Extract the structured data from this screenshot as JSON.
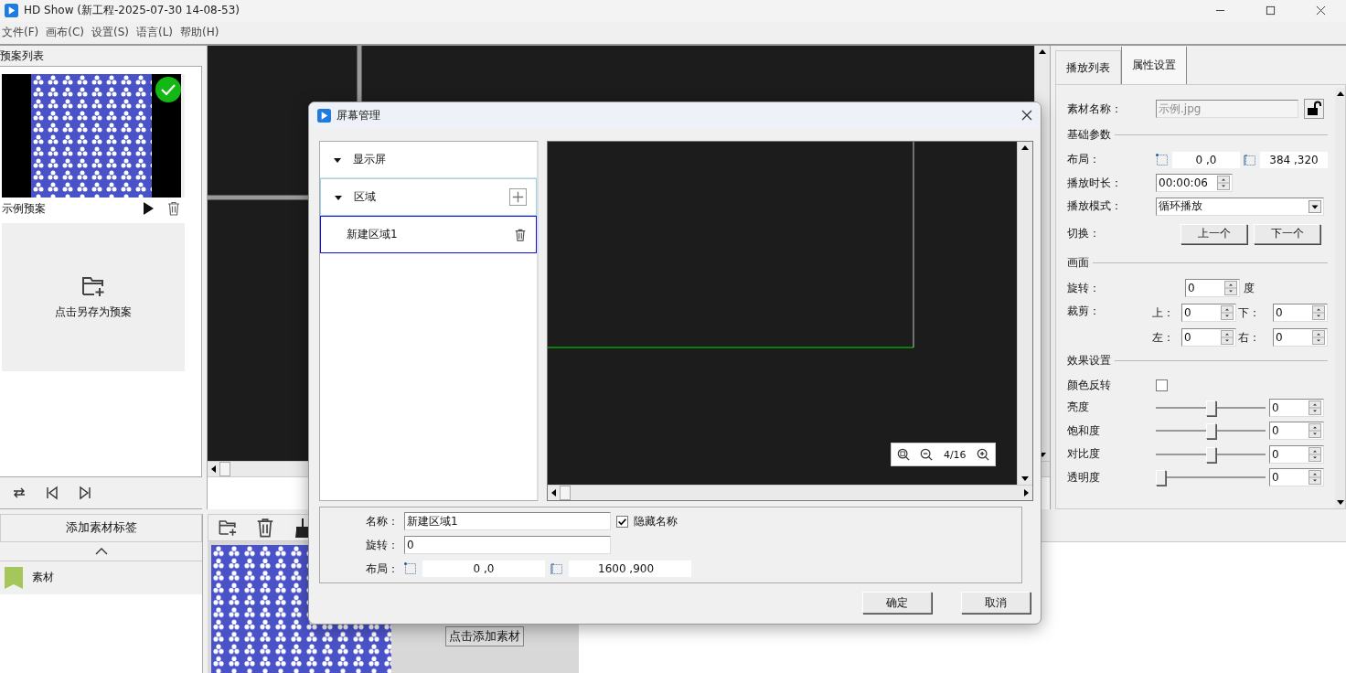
{
  "window": {
    "title": "HD Show (新工程-2025-07-30 14-08-53)"
  },
  "menu": [
    "文件(F)",
    "画布(C)",
    "设置(S)",
    "语言(L)",
    "帮助(H)"
  ],
  "presets": {
    "title": "预案列表",
    "items": [
      {
        "name": "示例预案",
        "selected": true,
        "kind": "picture"
      }
    ],
    "save_card": "点击另存为预案"
  },
  "material_tags": {
    "add_button": "添加素材标签",
    "tags": [
      {
        "name": "素材"
      }
    ]
  },
  "material_area": {
    "add_button": "点击添加素材"
  },
  "side_tabs": [
    {
      "label": "播放列表",
      "selected": false
    },
    {
      "label": "属性设置",
      "selected": true
    }
  ],
  "properties": {
    "material_name": {
      "label": "素材名称：",
      "value": "示例.jpg",
      "disabled": true
    },
    "basic": {
      "title": "基础参数",
      "layout": {
        "label": "布局：",
        "position": "0 ,0",
        "size": "384 ,320"
      },
      "duration": {
        "label": "播放时长：",
        "value": "00:00:06"
      },
      "mode": {
        "label": "播放模式：",
        "value": "循环播放"
      },
      "switch": {
        "label": "切换：",
        "buttons": [
          "上一个",
          "下一个"
        ]
      }
    },
    "picture": {
      "title": "画面",
      "rotate": {
        "label": "旋转：",
        "value": "0",
        "unit": "度"
      },
      "crop": {
        "label": "裁剪：",
        "sides": [
          {
            "label": "上：",
            "value": "0"
          },
          {
            "label": "下：",
            "value": "0"
          },
          {
            "label": "左：",
            "value": "0"
          },
          {
            "label": "右：",
            "value": "0"
          }
        ]
      }
    },
    "effects": {
      "title": "效果设置",
      "invert": {
        "label": "颜色反转",
        "checked": false
      },
      "sliders": [
        {
          "label": "亮度",
          "level": 0.5,
          "value": "0"
        },
        {
          "label": "饱和度",
          "level": 0.5,
          "value": "0"
        },
        {
          "label": "对比度",
          "level": 0.5,
          "value": "0"
        },
        {
          "label": "透明度",
          "level": 0,
          "value": "0"
        }
      ]
    }
  },
  "dialog": {
    "title": "屏幕管理",
    "tree": [
      {
        "label": "显示屏",
        "expanded": true,
        "selected": false
      },
      {
        "label": "区域",
        "expanded": true,
        "selected": false,
        "children": [
          {
            "label": "新建区域1",
            "selected": true
          }
        ]
      }
    ],
    "zoom": "4/16",
    "form": {
      "name": {
        "label": "名称：",
        "value": "新建区域1"
      },
      "hide_name": {
        "label": "隐藏名称",
        "checked": true
      },
      "rotate": {
        "label": "旋转：",
        "value": "0"
      },
      "layout": {
        "label": "布局：",
        "position": "0 ,0",
        "size": "1600 ,900"
      }
    },
    "buttons": [
      "确定",
      "取消"
    ]
  }
}
